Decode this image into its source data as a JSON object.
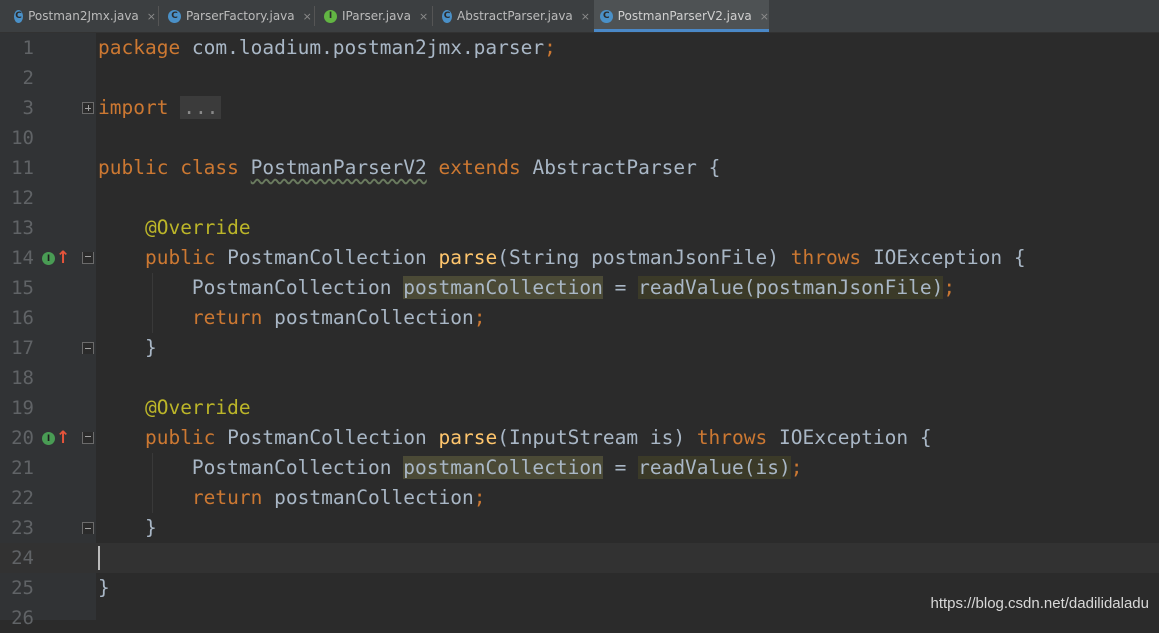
{
  "tabs": [
    {
      "label": "Postman2Jmx.java",
      "icon": "class-icon",
      "icon_letter": "C",
      "icon_color": "#4a90c7",
      "active": false
    },
    {
      "label": "ParserFactory.java",
      "icon": "class-icon",
      "icon_letter": "C",
      "icon_color": "#4a90c7",
      "active": false
    },
    {
      "label": "IParser.java",
      "icon": "interface-icon",
      "icon_letter": "I",
      "icon_color": "#62b543",
      "active": false
    },
    {
      "label": "AbstractParser.java",
      "icon": "abstract-class-icon",
      "icon_letter": "C",
      "icon_color": "#4a90c7",
      "active": false
    },
    {
      "label": "PostmanParserV2.java",
      "icon": "class-icon",
      "icon_letter": "C",
      "icon_color": "#4a90c7",
      "active": true
    }
  ],
  "close_glyph": "×",
  "lines": {
    "l1": "1",
    "l2": "2",
    "l3": "3",
    "l10": "10",
    "l11": "11",
    "l12": "12",
    "l13": "13",
    "l14": "14",
    "l15": "15",
    "l16": "16",
    "l17": "17",
    "l18": "18",
    "l19": "19",
    "l20": "20",
    "l21": "21",
    "l22": "22",
    "l23": "23",
    "l24": "24",
    "l25": "25",
    "l26": "26"
  },
  "code": {
    "package_kw": "package",
    "package_name": " com.loadium.postman2jmx.parser",
    "semicolon": ";",
    "import_kw": "import",
    "import_fold": "...",
    "public_kw": "public",
    "class_kw": "class",
    "class_name": "PostmanParserV2",
    "extends_kw": "extends",
    "super_name": "AbstractParser",
    "open_brace": " {",
    "close_brace": "}",
    "override": "@Override",
    "return_type": "PostmanCollection",
    "method_name": "parse",
    "param1": "(String postmanJsonFile)",
    "param2": "(InputStream is)",
    "throws_kw": "throws",
    "exception": "IOException",
    "local_type": "PostmanCollection",
    "local_var": "postmanCollection",
    "assign": " = ",
    "read_value": "readValue",
    "arg1": "(postmanJsonFile)",
    "arg2": "(is)",
    "return_kw": "return",
    "return_expr": " postmanCollection"
  },
  "gutter_icons": {
    "implements_letter": "I",
    "override_arrow": "↑"
  },
  "watermark": "https://blog.csdn.net/dadilidaladu",
  "colors": {
    "background": "#2b2b2b",
    "keyword": "#cc7832",
    "annotation": "#bbb529",
    "method": "#ffc66d",
    "text": "#a9b7c6",
    "line_number": "#606366",
    "accent": "#4a88c7"
  }
}
